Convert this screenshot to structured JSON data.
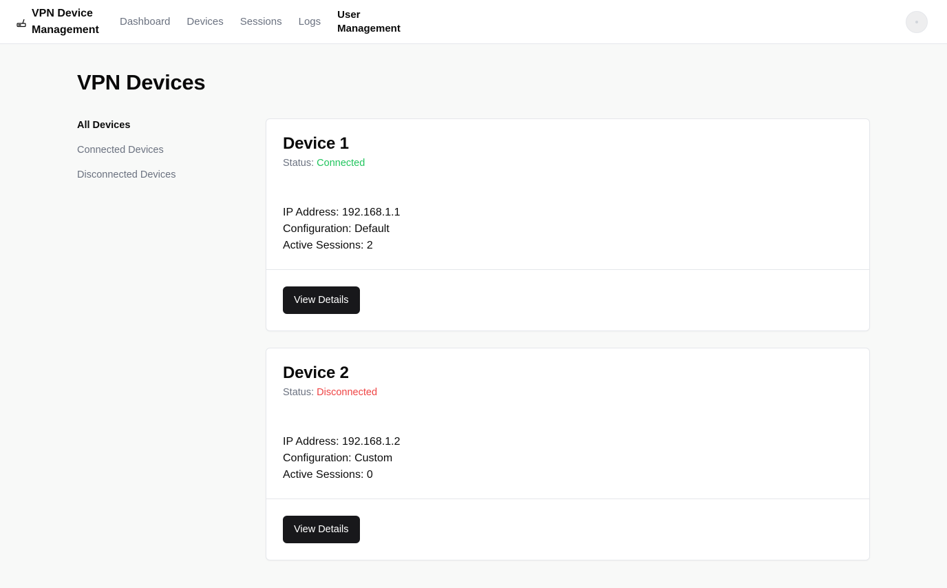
{
  "header": {
    "brand": "VPN Device Management",
    "brand_icon": "router-icon",
    "nav": [
      {
        "label": "Dashboard",
        "active": false
      },
      {
        "label": "Devices",
        "active": false
      },
      {
        "label": "Sessions",
        "active": false
      },
      {
        "label": "Logs",
        "active": false
      },
      {
        "label": "User Management",
        "active": true
      }
    ]
  },
  "page": {
    "title": "VPN Devices"
  },
  "sidebar": {
    "items": [
      {
        "label": "All Devices",
        "active": true
      },
      {
        "label": "Connected Devices",
        "active": false
      },
      {
        "label": "Disconnected Devices",
        "active": false
      }
    ]
  },
  "devices": [
    {
      "name": "Device 1",
      "status_label": "Status:",
      "status": "Connected",
      "status_color": "#22c55e",
      "ip": "IP Address: 192.168.1.1",
      "config": "Configuration: Default",
      "sessions": "Active Sessions: 2",
      "button": "View Details"
    },
    {
      "name": "Device 2",
      "status_label": "Status:",
      "status": "Disconnected",
      "status_color": "#ef4444",
      "ip": "IP Address: 192.168.1.2",
      "config": "Configuration: Custom",
      "sessions": "Active Sessions: 0",
      "button": "View Details"
    }
  ],
  "colors": {
    "accent": "#18181b",
    "muted": "#6b7280",
    "background": "#f8f9f8"
  }
}
